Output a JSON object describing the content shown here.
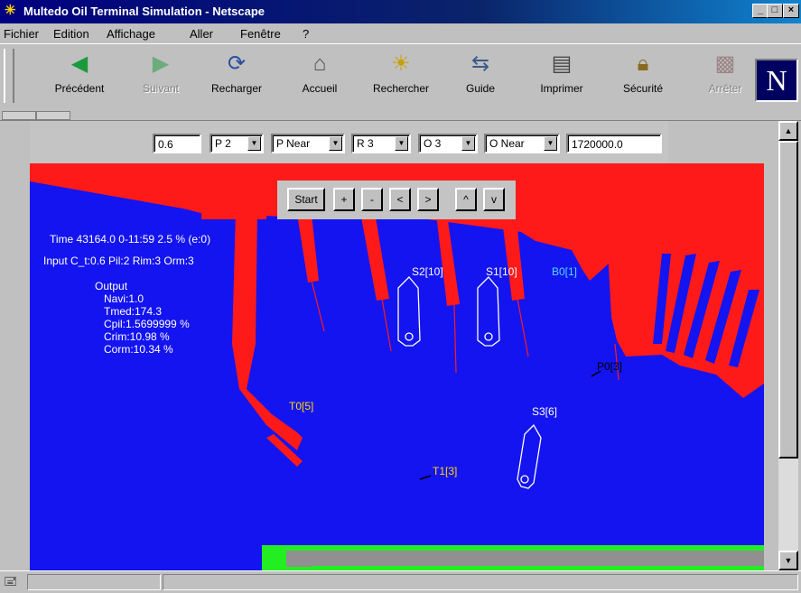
{
  "window": {
    "title": "Multedo Oil Terminal Simulation - Netscape",
    "buttons": [
      "_",
      "□",
      "×"
    ]
  },
  "menu": [
    "Fichier",
    "Edition",
    "Affichage",
    "Aller",
    "Fenêtre",
    "?"
  ],
  "toolbar": {
    "buttons": [
      {
        "label": "Précédent",
        "icon": "back-arrow-icon",
        "enabled": true
      },
      {
        "label": "Suivant",
        "icon": "forward-arrow-icon",
        "enabled": false
      },
      {
        "label": "Recharger",
        "icon": "reload-icon",
        "enabled": true
      },
      {
        "label": "Accueil",
        "icon": "home-icon",
        "enabled": true
      },
      {
        "label": "Rechercher",
        "icon": "search-icon",
        "enabled": true
      },
      {
        "label": "Guide",
        "icon": "guide-icon",
        "enabled": true
      },
      {
        "label": "Imprimer",
        "icon": "print-icon",
        "enabled": true
      },
      {
        "label": "Sécurité",
        "icon": "lock-icon",
        "enabled": true
      },
      {
        "label": "Arrêter",
        "icon": "stop-icon",
        "enabled": false
      }
    ],
    "logo": "N"
  },
  "controls": {
    "ct_value": "0.6",
    "pilot_select": "P 2",
    "pilot_mode_select": "P Near",
    "rim_select": "R 3",
    "orm_select": "O 3",
    "orm_mode_select": "O Near",
    "duration_value": "1720000.0"
  },
  "sim_buttons": [
    "Start",
    "+",
    "-",
    "<",
    ">",
    "^",
    "v"
  ],
  "stats": {
    "time_line": "Time 43164.0  0-11:59  2.5 % (e:0)",
    "input_line": "Input C_t:0.6 Pil:2 Rim:3 Orm:3",
    "output_title": "Output",
    "output_lines": [
      "Navi:1.0",
      "Tmed:174.3",
      "Cpil:1.5699999 %",
      "Crim:10.98 %",
      "Corm:10.34 %"
    ]
  },
  "map_labels": {
    "s2": "S2[10]",
    "s1": "S1[10]",
    "s3": "S3[6]",
    "b": "B0[1]",
    "p": "P0[3]",
    "t0": "T0[5]",
    "t1": "T1[3]"
  },
  "colors": {
    "sea": "#1414f0",
    "land": "#ff1a1a",
    "ship_outline": "#ffffff",
    "label_yellow": "#ffd800",
    "label_cyan": "#5ad8ff",
    "progress_green": "#22ee22"
  }
}
